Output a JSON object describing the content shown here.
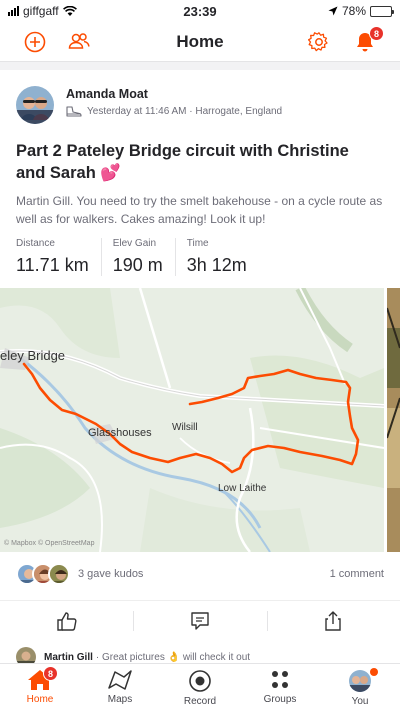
{
  "status_bar": {
    "carrier": "giffgaff",
    "time": "23:39",
    "battery": "78%",
    "battery_level": 0.78
  },
  "header": {
    "title": "Home",
    "notification_count": "8"
  },
  "activity": {
    "athlete_name": "Amanda Moat",
    "meta": "Yesterday at 11:46 AM · Harrogate, England",
    "title": "Part 2 Pateley Bridge circuit with Christine and Sarah 💕",
    "description": "Martin Gill. You need to try the smelt bakehouse - on a cycle route as well as for walkers. Cakes amazing! Look it up!",
    "stats": [
      {
        "label": "Distance",
        "value": "11.71 km"
      },
      {
        "label": "Elev Gain",
        "value": "190 m"
      },
      {
        "label": "Time",
        "value": "3h 12m"
      }
    ],
    "map": {
      "labels": {
        "pateley": "eley Bridge",
        "glasshouses": "Glasshouses",
        "wilsill": "Wilsill",
        "low_laithe": "Low Laithe",
        "attribution": "© Mapbox © OpenStreetMap"
      }
    },
    "kudos_text": "3 gave kudos",
    "comment_count": "1 comment",
    "comment_preview": {
      "author": "Martin Gill",
      "text": "· Great pictures 👌 will check it out"
    }
  },
  "tabs": [
    {
      "label": "Home",
      "icon": "home-icon",
      "badge": "8"
    },
    {
      "label": "Maps",
      "icon": "map-icon"
    },
    {
      "label": "Record",
      "icon": "record-icon"
    },
    {
      "label": "Groups",
      "icon": "groups-icon"
    },
    {
      "label": "You",
      "icon": "profile-avatar"
    }
  ],
  "colors": {
    "accent": "#fc4c02",
    "route": "#fc4c02",
    "badge": "#e8322a"
  }
}
